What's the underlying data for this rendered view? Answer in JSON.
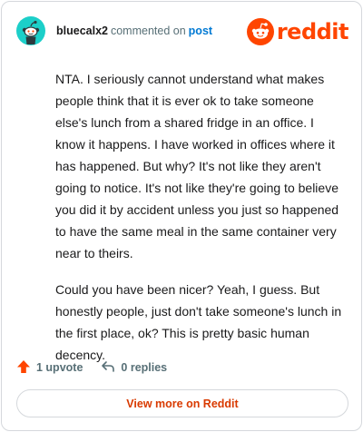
{
  "header": {
    "username": "bluecalx2",
    "commented_on": "commented on",
    "post_link": "post",
    "logo_text": "reddit",
    "avatar_icon": "snoo-avatar-icon",
    "logo_icon": "reddit-alien-icon"
  },
  "comment": {
    "paragraphs": [
      "NTA. I seriously cannot understand what makes people think that it is ever ok to take someone else's lunch from a shared fridge in an office. I know it happens. I have worked in offices where it has happened. But why? It's not like they aren't going to notice. It's not like they're going to believe you did it by accident unless you just so happened to have the same meal in the same container very near to theirs.",
      "Could you have been nicer? Yeah, I guess. But honestly people, just don't take someone's lunch in the first place, ok? This is pretty basic human decency."
    ]
  },
  "actions": {
    "upvote_label": "1 upvote",
    "upvote_icon": "upvote-arrow-icon",
    "replies_label": "0 replies",
    "reply_icon": "reply-arrow-icon"
  },
  "footer": {
    "view_more_label": "View more on Reddit"
  },
  "colors": {
    "brand": "#ff4500",
    "link": "#0079d3",
    "avatar_bg": "#1ccfc9",
    "muted": "#576f76"
  }
}
